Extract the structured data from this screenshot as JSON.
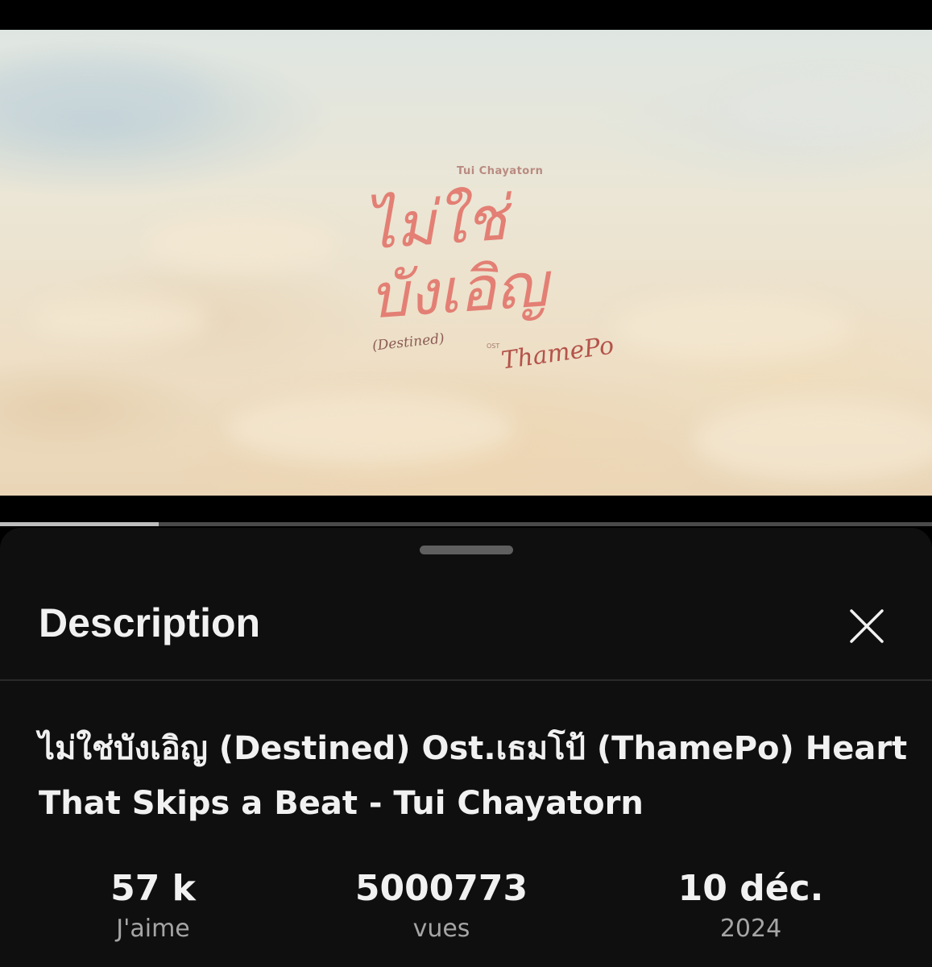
{
  "video": {
    "overlay_credit": "Tui Chayatorn",
    "overlay_title": "ไม่ใช่\nบังเอิญ",
    "overlay_subtitle": "(Destined)",
    "overlay_ost_small": "OST",
    "overlay_ost_logo": "ThamePo",
    "progress": 0.17
  },
  "sheet": {
    "title": "Description",
    "close_icon": "close-icon",
    "video_title": "ไม่ใช่บังเอิญ (Destined) Ost.เธมโป้ (ThamePo) Heart That Skips a Beat - Tui Chayatorn",
    "stats": [
      {
        "value": "57 k",
        "label": "J'aime"
      },
      {
        "value": "5000773",
        "label": "vues"
      },
      {
        "value": "10 déc.",
        "label": "2024"
      }
    ]
  },
  "colors": {
    "sheet_bg": "#0f0f0f",
    "text_primary": "#f1f1f1",
    "text_secondary": "#a5a5a5",
    "overlay_title": "#e37f74"
  }
}
